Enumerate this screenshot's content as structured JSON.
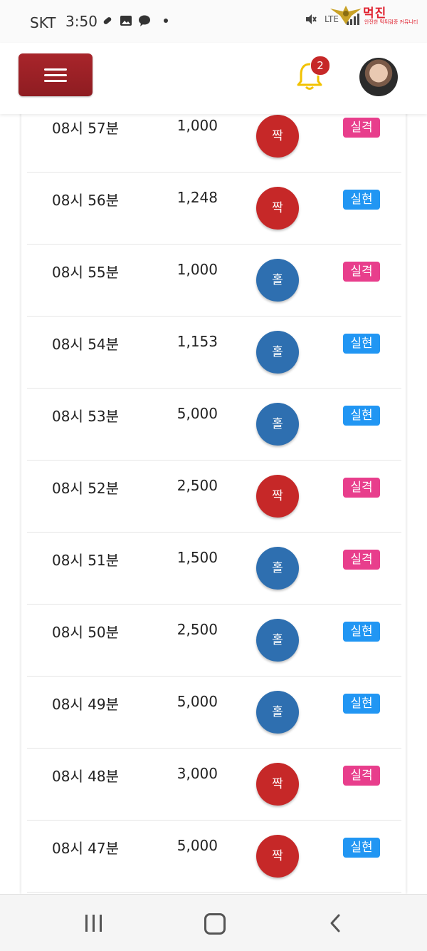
{
  "status_bar": {
    "carrier": "SKT",
    "time": "3:50",
    "network": "LTE"
  },
  "watermark": {
    "text": "먹진",
    "subtext": "안전한 먹튀검증 커뮤니티"
  },
  "header": {
    "notification_count": "2"
  },
  "rows": [
    {
      "time": "08시 57분",
      "amount": "1,000",
      "result": "짝",
      "status": "실격"
    },
    {
      "time": "08시 56분",
      "amount": "1,248",
      "result": "짝",
      "status": "실현"
    },
    {
      "time": "08시 55분",
      "amount": "1,000",
      "result": "홀",
      "status": "실격"
    },
    {
      "time": "08시 54분",
      "amount": "1,153",
      "result": "홀",
      "status": "실현"
    },
    {
      "time": "08시 53분",
      "amount": "5,000",
      "result": "홀",
      "status": "실현"
    },
    {
      "time": "08시 52분",
      "amount": "2,500",
      "result": "짝",
      "status": "실격"
    },
    {
      "time": "08시 51분",
      "amount": "1,500",
      "result": "홀",
      "status": "실격"
    },
    {
      "time": "08시 50분",
      "amount": "2,500",
      "result": "홀",
      "status": "실현"
    },
    {
      "time": "08시 49분",
      "amount": "5,000",
      "result": "홀",
      "status": "실현"
    },
    {
      "time": "08시 48분",
      "amount": "3,000",
      "result": "짝",
      "status": "실격"
    },
    {
      "time": "08시 47분",
      "amount": "5,000",
      "result": "짝",
      "status": "실현"
    }
  ],
  "colors": {
    "even_result": "#c62828",
    "odd_result": "#2e6fb0",
    "fail_status": "#e83e8c",
    "success_status": "#2196f3",
    "menu_button": "#9b2026",
    "bell": "#f2c200"
  }
}
